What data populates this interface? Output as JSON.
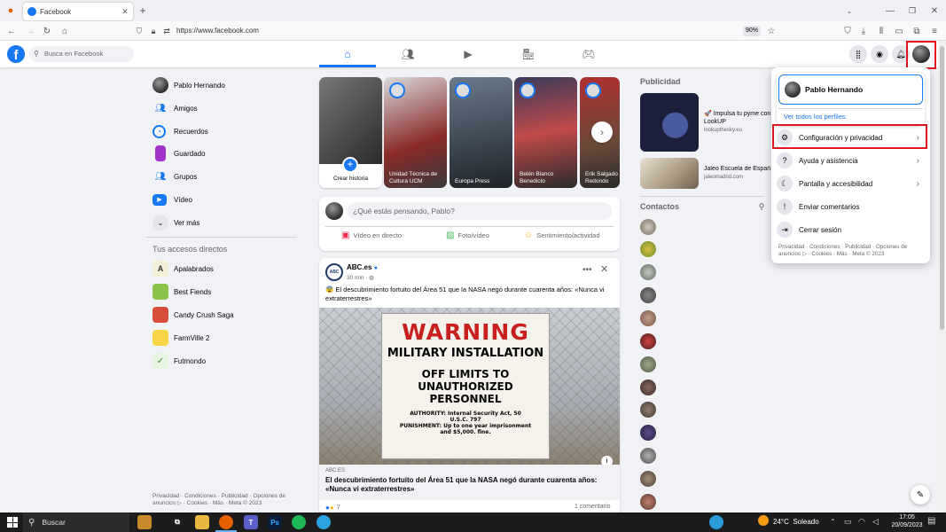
{
  "browser": {
    "tab_title": "Facebook",
    "url": "https://www.facebook.com",
    "zoom": "90%"
  },
  "header": {
    "search_placeholder": "Busca en Facebook"
  },
  "left_sidebar": {
    "user_name": "Pablo Hernando",
    "items": [
      {
        "label": "Amigos"
      },
      {
        "label": "Recuerdos"
      },
      {
        "label": "Guardado"
      },
      {
        "label": "Grupos"
      },
      {
        "label": "Vídeo"
      },
      {
        "label": "Ver más"
      }
    ],
    "shortcuts_title": "Tus accesos directos",
    "shortcuts": [
      {
        "label": "Apalabrados"
      },
      {
        "label": "Best Fiends"
      },
      {
        "label": "Candy Crush Saga"
      },
      {
        "label": "FarmVille 2"
      },
      {
        "label": "Futmondo"
      }
    ],
    "footer": "Privacidad · Condiciones · Publicidad · Opciones de anuncios ▷ · Cookies · Más · Meta © 2023"
  },
  "stories": [
    {
      "label": "Crear historia"
    },
    {
      "label": "Unidad Técnica de Cultura UCM"
    },
    {
      "label": "Europa Press"
    },
    {
      "label": "Belén Blanco Benedicto"
    },
    {
      "label": "Erik Salgado Redondo"
    }
  ],
  "composer": {
    "placeholder": "¿Qué estás pensando, Pablo?",
    "actions": [
      {
        "label": "Vídeo en directo"
      },
      {
        "label": "Foto/vídeo"
      },
      {
        "label": "Sentimiento/actividad"
      }
    ]
  },
  "post": {
    "author": "ABC.es",
    "time": "30 min · ",
    "text": "😨 El descubrimiento fortuito del Área 51 que la NASA negó durante cuarenta años: «Nunca vi extraterrestres»",
    "sign": {
      "line1": "WARNING",
      "line2": "MILITARY INSTALLATION",
      "line3": "OFF LIMITS TO",
      "line4": "UNAUTHORIZED PERSONNEL",
      "line5": "AUTHORITY: Internal Security Act, 50",
      "line6": "U.S.C. 797",
      "line7": "PUNISHMENT: Up to one year imprisonment",
      "line8": "and $5,000. fine."
    },
    "link_domain": "ABC.ES",
    "link_title": "El descubrimiento fortuito del Área 51 que la NASA negó durante cuarenta años: «Nunca vi extraterrestres»",
    "reactions": "7",
    "comments": "1 comentario"
  },
  "right_column": {
    "ads_title": "Publicidad",
    "ads": [
      {
        "title": "🚀 Impulsa tu pyme con LookUP",
        "domain": "lookupthesky.eu"
      },
      {
        "title": "Jaleo Escuela de Españ",
        "domain": "jaleomadrid.com"
      }
    ],
    "contacts_title": "Contactos"
  },
  "account_menu": {
    "profile_name": "Pablo Hernando",
    "see_all_profiles": "Ver todos los perfiles",
    "items": [
      {
        "label": "Configuración y privacidad"
      },
      {
        "label": "Ayuda y asistencia"
      },
      {
        "label": "Pantalla y accesibilidad"
      },
      {
        "label": "Enviar comentarios"
      },
      {
        "label": "Cerrar sesión"
      }
    ],
    "footer": "Privacidad · Condiciones · Publicidad · Opciones de anuncios ▷ · Cookies · Más · Meta © 2023"
  },
  "taskbar": {
    "search_label": "Buscar",
    "weather": "24°C  Soleado",
    "time": "17:05",
    "date": "20/09/2023"
  },
  "colors": {
    "facebook_blue": "#1877f2",
    "highlight_red": "#e0141e"
  }
}
